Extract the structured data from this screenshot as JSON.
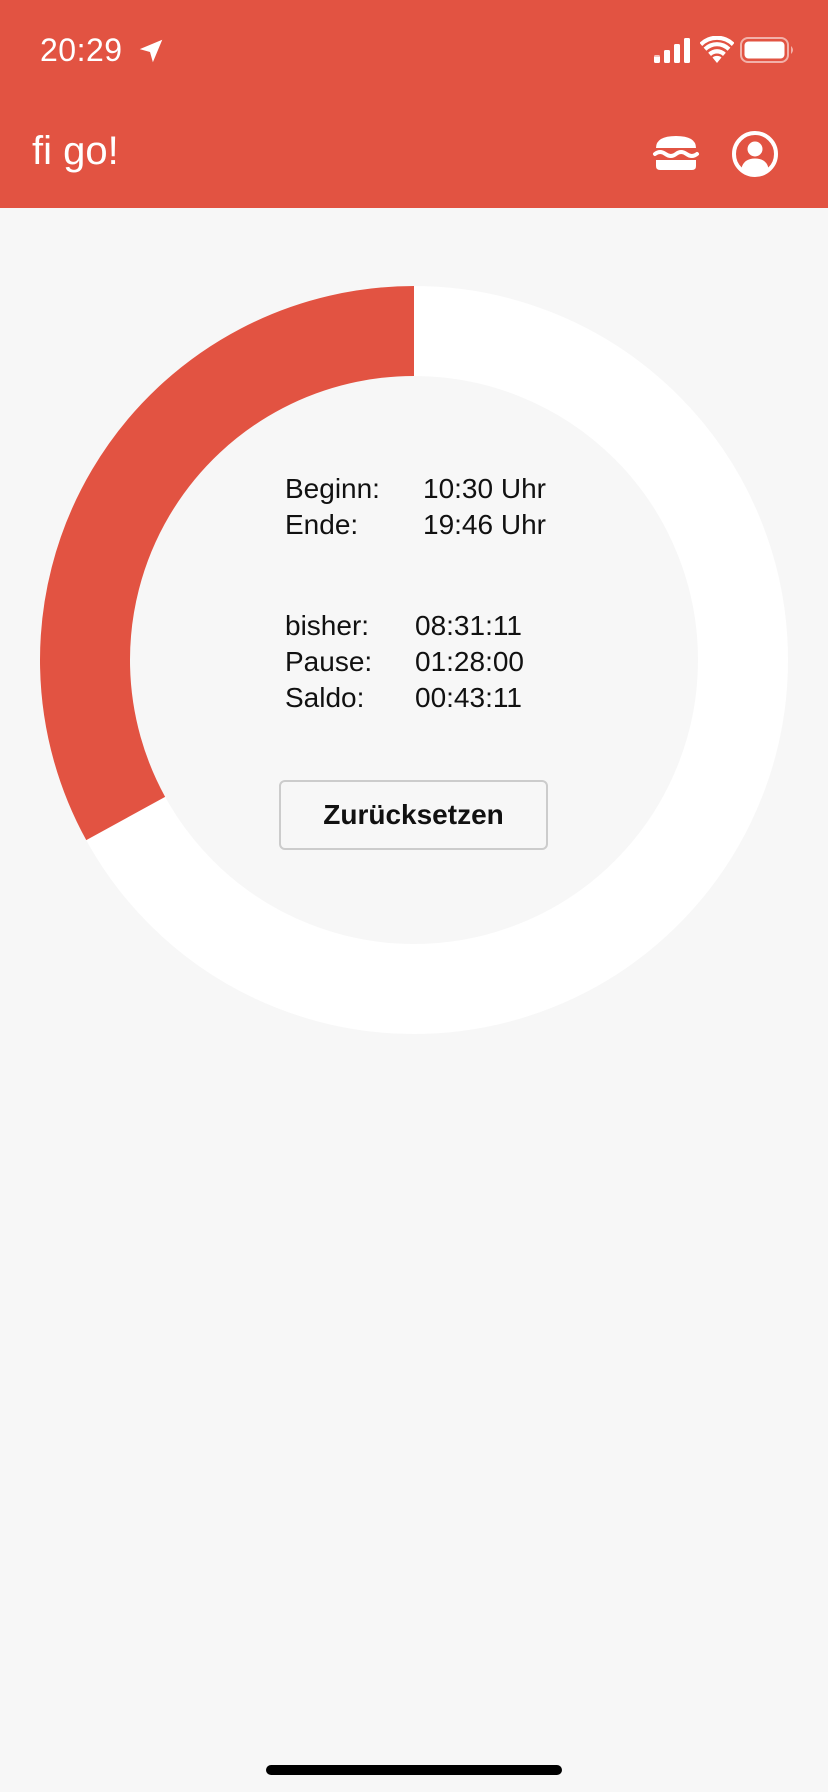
{
  "status_bar": {
    "time": "20:29"
  },
  "header": {
    "title": "fi go!",
    "background": "#e25342"
  },
  "ring": {
    "progress": 0.33,
    "filled_color": "#e25342",
    "track_color": "#ffffff"
  },
  "info": {
    "begin_label": "Beginn:",
    "begin_value": "10:30 Uhr",
    "end_label": "Ende:",
    "end_value": "19:46 Uhr",
    "elapsed_label": "bisher:",
    "elapsed_value": "08:31:11",
    "pause_label": "Pause:",
    "pause_value": "01:28:00",
    "balance_label": "Saldo:",
    "balance_value": "00:43:11"
  },
  "actions": {
    "reset_label": "Zurücksetzen"
  },
  "icons": {
    "location": "location-arrow-icon",
    "signal": "cellular-signal-icon",
    "wifi": "wifi-icon",
    "battery": "battery-icon",
    "burger": "burger-icon",
    "account": "account-circle-icon"
  }
}
